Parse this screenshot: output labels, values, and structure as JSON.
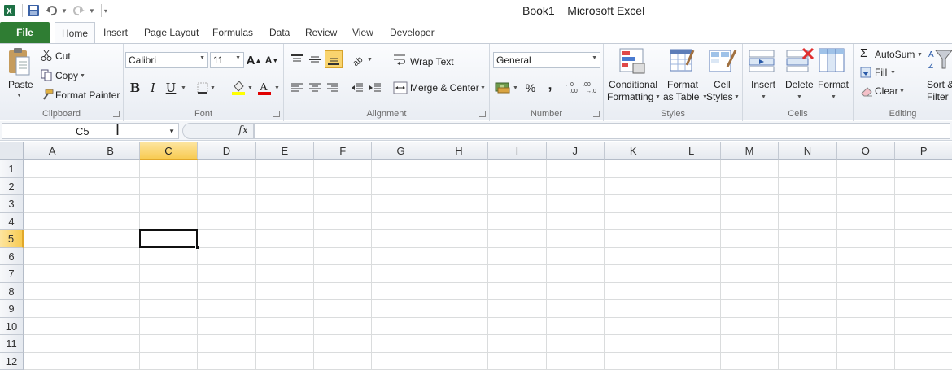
{
  "window": {
    "workbook": "Book1",
    "app": "Microsoft Excel",
    "colors": {
      "file_tab": "#2f7d33",
      "active_header": "#f8cb52",
      "excel_green": "#1e7145"
    }
  },
  "qat": {
    "icons": [
      "excel-logo-icon",
      "save-icon",
      "undo-icon",
      "redo-icon",
      "customize-qat-icon"
    ]
  },
  "tabs": [
    "File",
    "Home",
    "Insert",
    "Page Layout",
    "Formulas",
    "Data",
    "Review",
    "View",
    "Developer"
  ],
  "active_tab": "Home",
  "ribbon": {
    "clipboard": {
      "label": "Clipboard",
      "paste": "Paste",
      "cut": "Cut",
      "copy": "Copy",
      "format_painter": "Format Painter"
    },
    "font": {
      "label": "Font",
      "font_name": "Calibri",
      "font_size": "11",
      "bold": "B",
      "italic": "I",
      "underline": "U",
      "font_color_glyph": "A",
      "grow_glyph": "A",
      "shrink_glyph": "A"
    },
    "alignment": {
      "label": "Alignment",
      "wrap_text": "Wrap Text",
      "merge_center": "Merge & Center"
    },
    "number": {
      "label": "Number",
      "format": "General",
      "percent": "%",
      "comma": ","
    },
    "styles": {
      "label": "Styles",
      "conditional_line1": "Conditional",
      "conditional_line2": "Formatting",
      "table_line1": "Format",
      "table_line2": "as Table",
      "cell_line1": "Cell",
      "cell_line2": "Styles"
    },
    "cells": {
      "label": "Cells",
      "insert": "Insert",
      "delete": "Delete",
      "format": "Format"
    },
    "editing": {
      "label": "Editing",
      "autosum": "AutoSum",
      "fill": "Fill",
      "clear": "Clear",
      "sort_line1": "Sort &",
      "sort_line2": "Filter"
    }
  },
  "formula_bar": {
    "name_box": "C5",
    "fx": "fx",
    "formula": ""
  },
  "grid": {
    "columns": [
      "A",
      "B",
      "C",
      "D",
      "E",
      "F",
      "G",
      "H",
      "I",
      "J",
      "K",
      "L",
      "M",
      "N",
      "O",
      "P"
    ],
    "rows": [
      "1",
      "2",
      "3",
      "4",
      "5",
      "6",
      "7",
      "8",
      "9",
      "10",
      "11",
      "12"
    ],
    "active_cell": {
      "column": "C",
      "row": "5"
    }
  }
}
